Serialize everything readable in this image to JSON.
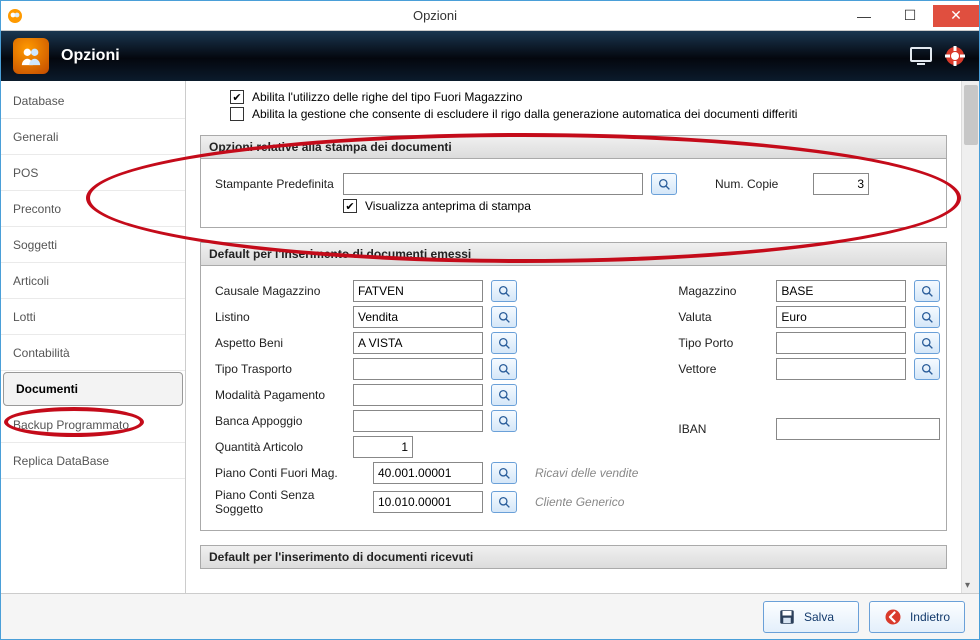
{
  "os_title": "Opzioni",
  "app_title": "Opzioni",
  "sidebar": {
    "items": [
      {
        "label": "Database"
      },
      {
        "label": "Generali"
      },
      {
        "label": "POS"
      },
      {
        "label": "Preconto"
      },
      {
        "label": "Soggetti"
      },
      {
        "label": "Articoli"
      },
      {
        "label": "Lotti"
      },
      {
        "label": "Contabilità"
      },
      {
        "label": "Documenti"
      },
      {
        "label": "Backup Programmato"
      },
      {
        "label": "Replica DataBase"
      }
    ],
    "active_index": 8
  },
  "top_checks": {
    "abilita_fuori_mag": "Abilita l'utilizzo delle righe del tipo Fuori Magazzino",
    "abilita_gestione_escludere": "Abilita la gestione che consente di escludere il rigo dalla generazione automatica dei documenti differiti"
  },
  "group_stampa": {
    "title": "Opzioni relative alla stampa dei documenti",
    "stampante_label": "Stampante Predefinita",
    "stampante_value": "",
    "num_copie_label": "Num. Copie",
    "num_copie_value": "3",
    "anteprima_label": "Visualizza anteprima di stampa"
  },
  "group_emessi": {
    "title": "Default per l'inserimento di documenti emessi",
    "causale_label": "Causale Magazzino",
    "causale_value": "FATVEN",
    "listino_label": "Listino",
    "listino_value": "Vendita",
    "aspetto_label": "Aspetto Beni",
    "aspetto_value": "A VISTA",
    "trasporto_label": "Tipo Trasporto",
    "trasporto_value": "",
    "modpag_label": "Modalità Pagamento",
    "modpag_value": "",
    "banca_label": "Banca Appoggio",
    "banca_value": "",
    "qta_label": "Quantità Articolo",
    "qta_value": "1",
    "pcfm_label": "Piano Conti Fuori Mag.",
    "pcfm_value": "40.001.00001",
    "pcfm_hint": "Ricavi delle vendite",
    "pcss_label": "Piano Conti Senza Soggetto",
    "pcss_value": "10.010.00001",
    "pcss_hint": "Cliente Generico",
    "magazzino_label": "Magazzino",
    "magazzino_value": "BASE",
    "valuta_label": "Valuta",
    "valuta_value": "Euro",
    "porto_label": "Tipo Porto",
    "porto_value": "",
    "vettore_label": "Vettore",
    "vettore_value": "",
    "iban_label": "IBAN",
    "iban_value": ""
  },
  "group_ricevuti_title": "Default per l'inserimento di documenti ricevuti",
  "footer": {
    "salva": "Salva",
    "indietro": "Indietro"
  }
}
